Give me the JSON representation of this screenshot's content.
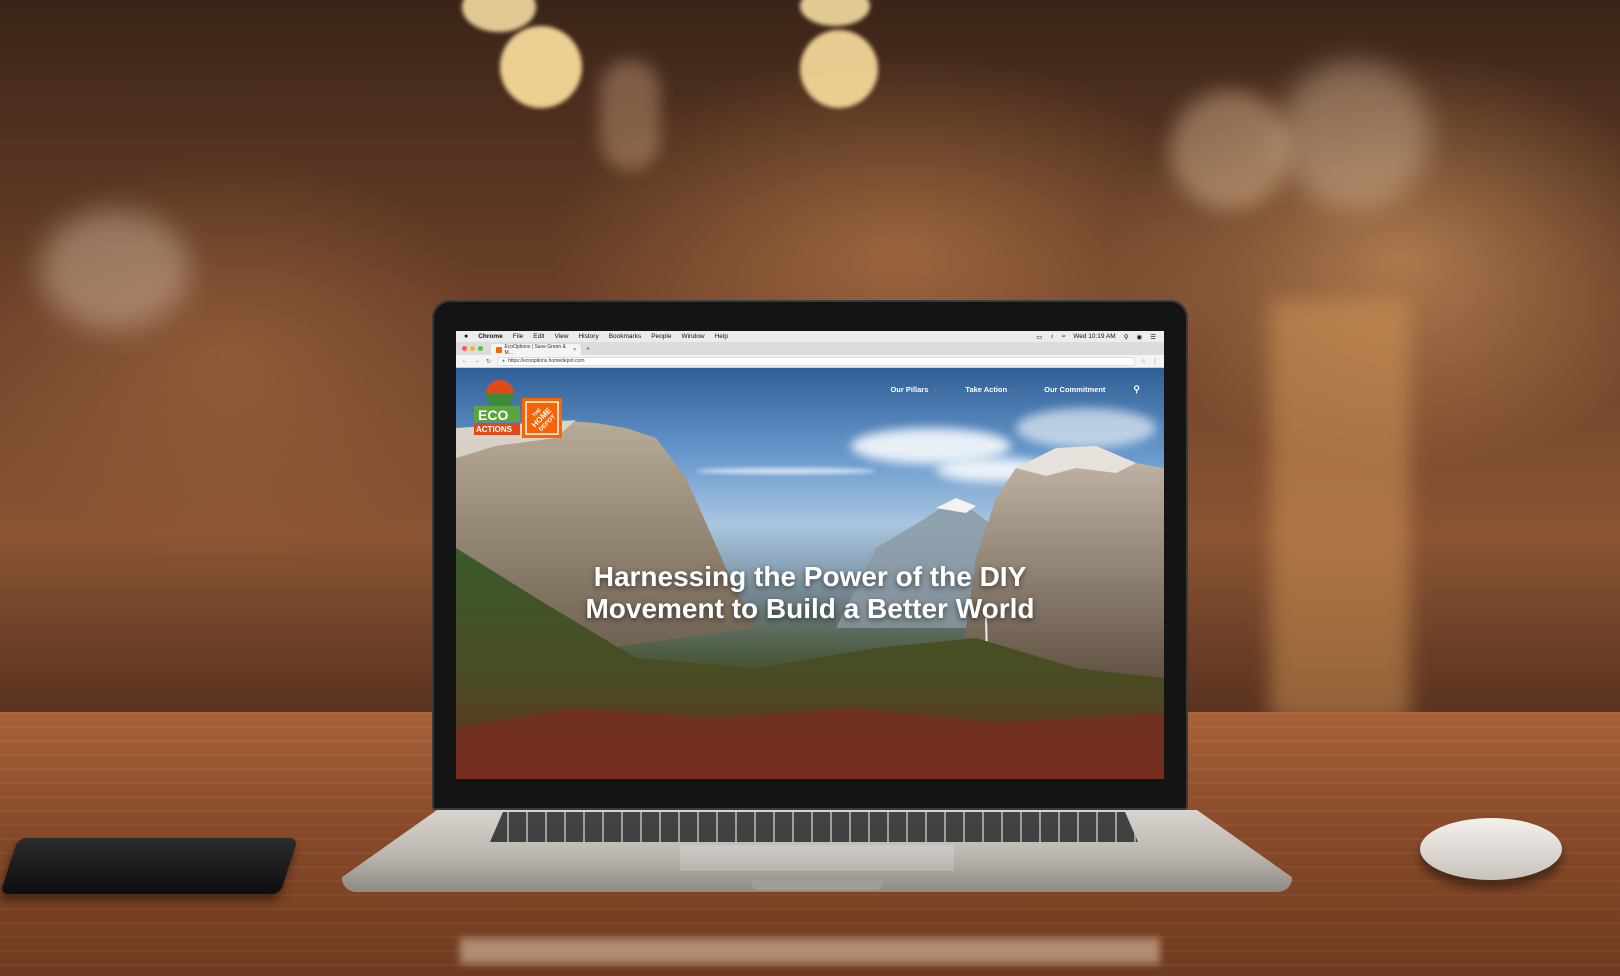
{
  "menubar": {
    "apple_icon": "apple-icon",
    "app_name": "Chrome",
    "items": [
      "File",
      "Edit",
      "View",
      "History",
      "Bookmarks",
      "People",
      "Window",
      "Help"
    ],
    "clock": "Wed 10:19 AM"
  },
  "browser": {
    "tab_title": "EcoOptions | Save Green & M...",
    "tab_close": "×",
    "new_tab": "+",
    "url": "https://ecooptions.homedepot.com"
  },
  "site": {
    "logo": {
      "eco": "ECO",
      "actions": "ACTIONS",
      "brand_top": "THE",
      "brand_mid": "HOME",
      "brand_bottom": "DEPOT",
      "brand_color": "#F96302"
    },
    "nav": [
      {
        "label": "Our Pillars",
        "has_dropdown": true
      },
      {
        "label": "Take Action",
        "has_dropdown": true
      },
      {
        "label": "Our Commitment",
        "has_dropdown": false
      }
    ],
    "search_icon": "search-icon",
    "hero_title": "Harnessing the Power of the DIY Movement to Build a Better World"
  }
}
